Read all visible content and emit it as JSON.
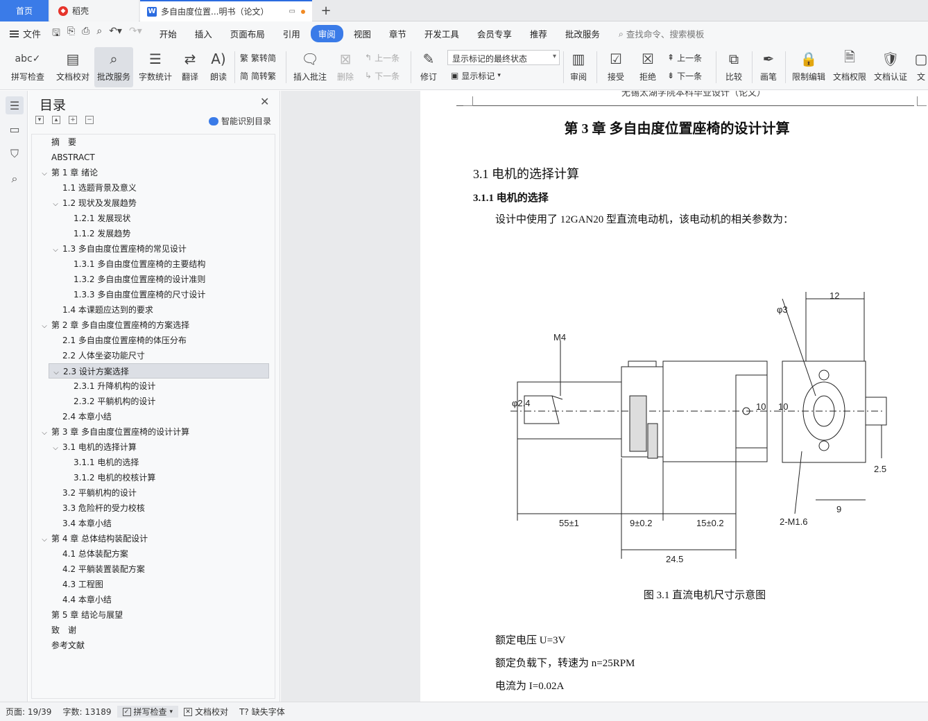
{
  "tabs": {
    "home": "首页",
    "wk": "稻壳",
    "doc": "多自由度位置...明书（论文）",
    "new": "+"
  },
  "menubar": {
    "file": "文件",
    "items": [
      "开始",
      "插入",
      "页面布局",
      "引用",
      "审阅",
      "视图",
      "章节",
      "开发工具",
      "会员专享",
      "推荐",
      "批改服务"
    ],
    "active_index": 4,
    "search": "查找命令、搜索模板"
  },
  "ribbon": {
    "spell": "拼写检查",
    "proof": "文档校对",
    "correct": "批改服务",
    "wordcount": "字数统计",
    "translate": "翻译",
    "read": "朗读",
    "t2s": "繁转简",
    "s2t": "简转繁",
    "insert_comment": "插入批注",
    "delete": "删除",
    "prev_comment": "上一条",
    "next_comment": "下一条",
    "revise": "修订",
    "markup_state": "显示标记的最终状态",
    "show_markup": "显示标记",
    "review": "审阅",
    "accept": "接受",
    "reject": "拒绝",
    "prev_change": "上一条",
    "next_change": "下一条",
    "compare": "比较",
    "pen": "画笔",
    "restrict": "限制编辑",
    "permission": "文档权限",
    "certify": "文档认证",
    "more": "文"
  },
  "toc": {
    "title": "目录",
    "smart": "智能识别目录",
    "items": [
      {
        "label": "摘　要",
        "level": 0,
        "tw": ""
      },
      {
        "label": "ABSTRACT",
        "level": 0,
        "tw": ""
      },
      {
        "label": "第 1 章  绪论",
        "level": 0,
        "tw": "v"
      },
      {
        "label": "1.1 选题背景及意义",
        "level": 1,
        "tw": ""
      },
      {
        "label": "1.2  现状及发展趋势",
        "level": 1,
        "tw": "v"
      },
      {
        "label": "1.2.1  发展现状",
        "level": 2,
        "tw": ""
      },
      {
        "label": "1.1.2  发展趋势",
        "level": 2,
        "tw": ""
      },
      {
        "label": "1.3 多自由度位置座椅的常见设计",
        "level": 1,
        "tw": "v"
      },
      {
        "label": "1.3.1  多自由度位置座椅的主要结构",
        "level": 2,
        "tw": ""
      },
      {
        "label": "1.3.2  多自由度位置座椅的设计准则",
        "level": 2,
        "tw": ""
      },
      {
        "label": "1.3.3  多自由度位置座椅的尺寸设计",
        "level": 2,
        "tw": ""
      },
      {
        "label": "1.4  本课题应达到的要求",
        "level": 1,
        "tw": ""
      },
      {
        "label": "第 2 章  多自由度位置座椅的方案选择",
        "level": 0,
        "tw": "v"
      },
      {
        "label": "2.1  多自由度位置座椅的体压分布",
        "level": 1,
        "tw": ""
      },
      {
        "label": "2.2 人体坐姿功能尺寸",
        "level": 1,
        "tw": ""
      },
      {
        "label": "2.3  设计方案选择",
        "level": 1,
        "tw": "v",
        "selected": true
      },
      {
        "label": "2.3.1  升降机构的设计",
        "level": 2,
        "tw": ""
      },
      {
        "label": "2.3.2  平躺机构的设计",
        "level": 2,
        "tw": ""
      },
      {
        "label": "2.4  本章小结",
        "level": 1,
        "tw": ""
      },
      {
        "label": "第 3 章  多自由度位置座椅的设计计算",
        "level": 0,
        "tw": "v"
      },
      {
        "label": "3.1 电机的选择计算",
        "level": 1,
        "tw": "v"
      },
      {
        "label": "3.1.1 电机的选择",
        "level": 2,
        "tw": ""
      },
      {
        "label": "3.1.2 电机的校核计算",
        "level": 2,
        "tw": ""
      },
      {
        "label": "3.2 平躺机构的设计",
        "level": 1,
        "tw": ""
      },
      {
        "label": "3.3 危险杆的受力校核",
        "level": 1,
        "tw": ""
      },
      {
        "label": "3.4 本章小结",
        "level": 1,
        "tw": ""
      },
      {
        "label": "第 4 章  总体结构装配设计",
        "level": 0,
        "tw": "v"
      },
      {
        "label": "4.1 总体装配方案",
        "level": 1,
        "tw": ""
      },
      {
        "label": "4.2 平躺装置装配方案",
        "level": 1,
        "tw": ""
      },
      {
        "label": "4.3  工程图",
        "level": 1,
        "tw": ""
      },
      {
        "label": "4.4 本章小结",
        "level": 1,
        "tw": ""
      },
      {
        "label": "第 5 章  结论与展望",
        "level": 0,
        "tw": ""
      },
      {
        "label": "致　谢",
        "level": 0,
        "tw": ""
      },
      {
        "label": "参考文献",
        "level": 0,
        "tw": ""
      }
    ]
  },
  "doc": {
    "header": "无锡太湖学院本科毕业设计（论文）",
    "chapter_title": "第 3 章  多自由度位置座椅的设计计算",
    "section_title": "3.1 电机的选择计算",
    "subsection_title": "3.1.1 电机的选择",
    "intro": "设计中使用了 12GAN20 型直流电动机，该电动机的相关参数为：",
    "figure_caption": "图 3.1  直流电机尺寸示意图",
    "params": [
      "额定电压 U=3V",
      "额定负载下，转速为 n=25RPM",
      "电流为 I=0.02A"
    ],
    "dims": {
      "m4": "M4",
      "d24": "φ2.4",
      "d10a": "10",
      "d10b": "10",
      "l55": "55±1",
      "l9": "9±0.2",
      "l15": "15±0.2",
      "l245": "24.5",
      "d3": "φ3",
      "w12": "12",
      "h25": "2.5",
      "w9": "9",
      "r16": "2-M1.6"
    }
  },
  "status": {
    "page": "页面: 19/39",
    "words": "字数: 13189",
    "spell": "拼写检查",
    "proof": "文档校对",
    "font": "缺失字体"
  }
}
